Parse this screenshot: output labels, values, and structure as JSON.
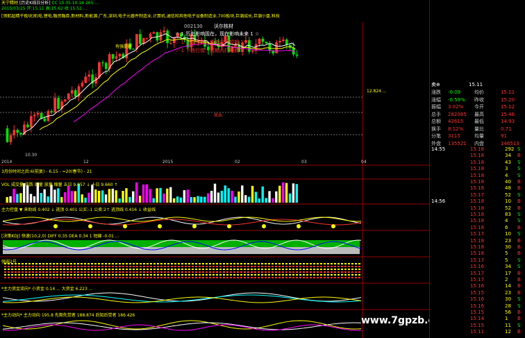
{
  "header": {
    "line1_prefix": "天宁精材",
    "line1_title": "[历史K线日分析]",
    "line1_values": "CC 15.05 10.14 265 ...",
    "line2": "2015/03/25  开:15.11  高:15.62  收:15.51  ...",
    "line3": "[领航超精干板块]机电,锂电,融资融券,新材料,新能源,广东,深圳,电子元器件制造业,计算机,通信和其他电子设备制造业,700板块,巨潮成长,巨潮小盘,科技"
  },
  "overlay": {
    "code": "002130",
    "name": "沃尔核材",
    "tip1": "☆ 1 历史影响现在，现在影响未来 1 ☆",
    "tip2": "☆ 1 上涨行情：周期内打短期 1 ☆",
    "tip3": "☆ 1 下跌行情：周期内打短期 1 ☆",
    "label_top": "有强提醒",
    "label_mid": "卖出",
    "label_bottom": "买入",
    "price_high": "12.824 ...",
    "price_low": "10.30"
  },
  "axis_dates": [
    "2014",
    "12",
    "2015",
    "02",
    "03",
    "04"
  ],
  "sub_labels": {
    "ma_line": "3月份时间之后:6(前复) - 6.15 - =20(春节) - 21",
    "vol": "VOL 成交量 涨跌 周量 放量 缩量 五日 9.657 ↓ 十日 9.660 ↑",
    "macd": "主力控盘 ▼ 来助线 0.402 ↓ 逃顶 0.401 公买:-1 公卖:2↑ 逃顶线 0.416 ↓ 收益线",
    "kdj": "[决策KDJ] 快速(10,2,0) DIFF 0.35 DEA 0.34 1 短線 -0.01 ...",
    "strength": "强弱2号",
    "bottom1": "*主力资金流向*  小资金 0.14 ...  大资金 6.223  ...",
    "bottom2": "*主力动向*  主力动向 195.8  先期先觉者 188.874  后知后觉者 186.426"
  },
  "quote": {
    "title": "卖⊕",
    "price_label": "15.11",
    "rows": [
      {
        "l": "涨跌",
        "v": "-0.09",
        "l2": "均价",
        "v2": "15.11"
      },
      {
        "l": "涨幅",
        "v": "-0.59%",
        "l2": "昨收",
        "v2": "15.20"
      },
      {
        "l": "振幅",
        "v": "3.02%",
        "l2": "今开",
        "v2": "15.12"
      },
      {
        "l": "总手",
        "v": "282085",
        "l2": "最高",
        "v2": "15.46"
      },
      {
        "l": "总额",
        "v": "42615",
        "l2": "最低",
        "v2": "14.93"
      },
      {
        "l": "换手",
        "v": "8.12%",
        "l2": "量比",
        "v2": "0.71"
      },
      {
        "l": "分笔",
        "v": "3115",
        "l2": "均量",
        "v2": "91"
      },
      {
        "l": "外盘",
        "v": "135521",
        "l2": "内盘",
        "v2": "146513"
      }
    ],
    "ticks": [
      {
        "t": "14:55",
        "p": "15.18",
        "v": "292",
        "d": "S"
      },
      {
        "t": "",
        "p": "15.18",
        "v": "34",
        "d": "B"
      },
      {
        "t": "",
        "p": "15.18",
        "v": "43",
        "d": "S"
      },
      {
        "t": "",
        "p": "15.18",
        "v": "3",
        "d": "S"
      },
      {
        "t": "",
        "p": "15.18",
        "v": "4",
        "d": "S"
      },
      {
        "t": "",
        "p": "15.18",
        "v": "40",
        "d": "B"
      },
      {
        "t": "",
        "p": "15.18",
        "v": "48",
        "d": "B"
      },
      {
        "t": "",
        "p": "15.17",
        "v": "52",
        "d": "S"
      },
      {
        "t": "14:56",
        "p": "15.18",
        "v": "10",
        "d": "B"
      },
      {
        "t": "",
        "p": "15.18",
        "v": "52",
        "d": "B"
      },
      {
        "t": "",
        "p": "15.18",
        "v": "83",
        "d": "S"
      },
      {
        "t": "",
        "p": "15.18",
        "v": "4",
        "d": "S"
      },
      {
        "t": "",
        "p": "15.18",
        "v": "6",
        "d": "B"
      },
      {
        "t": "",
        "p": "15.17",
        "v": "10",
        "d": "S"
      },
      {
        "t": "",
        "p": "15.18",
        "v": "23",
        "d": "B"
      },
      {
        "t": "",
        "p": "15.18",
        "v": "30",
        "d": "B"
      },
      {
        "t": "",
        "p": "15.18",
        "v": "5",
        "d": "B"
      },
      {
        "t": "",
        "p": "15.17",
        "v": "5",
        "d": "S"
      },
      {
        "t": "",
        "p": "15.16",
        "v": "34",
        "d": "S"
      },
      {
        "t": "",
        "p": "15.17",
        "v": "17",
        "d": "B"
      },
      {
        "t": "",
        "p": "15.17",
        "v": "2",
        "d": "B"
      },
      {
        "t": "",
        "p": "15.16",
        "v": "14",
        "d": "B"
      },
      {
        "t": "",
        "p": "15.15",
        "v": "23",
        "d": "B"
      },
      {
        "t": "",
        "p": "15.16",
        "v": "30",
        "d": "S"
      },
      {
        "t": "",
        "p": "15.16",
        "v": "28",
        "d": "S"
      },
      {
        "t": "",
        "p": "15.15",
        "v": "56",
        "d": "B"
      },
      {
        "t": "",
        "p": "15.14",
        "v": "1",
        "d": "B"
      },
      {
        "t": "",
        "p": "15.15",
        "v": "11",
        "d": "S"
      },
      {
        "t": "",
        "p": "15.11",
        "v": "12",
        "d": "B"
      }
    ]
  },
  "watermark": "www.7gpzb.com",
  "colors": {
    "up": "#ff3232",
    "down": "#00e0e0",
    "yellow": "#ffff00",
    "green": "#00c000",
    "grid": "#990000"
  }
}
